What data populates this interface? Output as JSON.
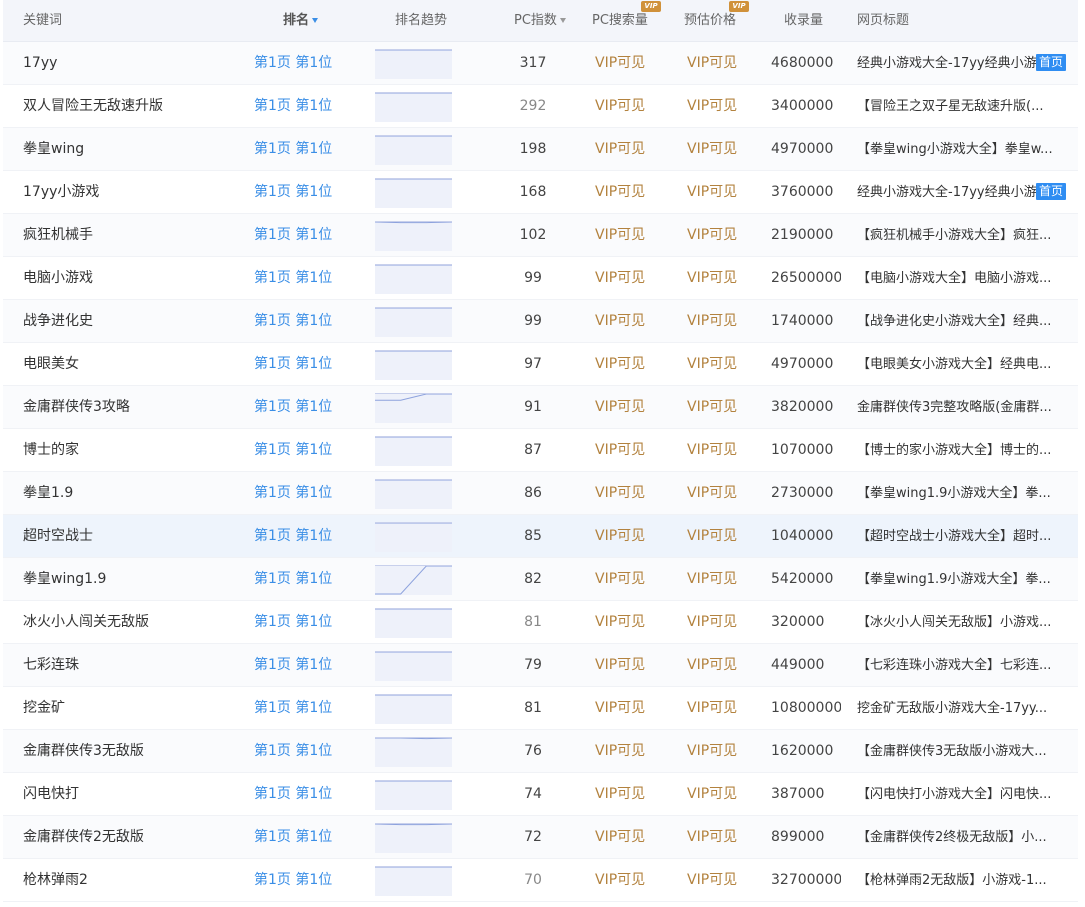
{
  "header": {
    "keyword": "关键词",
    "rank": "排名",
    "trend": "排名趋势",
    "pc_index": "PC指数",
    "pc_search": "PC搜索量",
    "est_price": "预估价格",
    "indexed": "收录量",
    "page_title": "网页标题",
    "vip_badge": "VIP"
  },
  "colors": {
    "accent": "#3a8ee6",
    "vip": "#b3823e",
    "badge": "#d0913a",
    "homepage_tag": "#2f8df2"
  },
  "rows": [
    {
      "keyword": "17yy",
      "rank": "第1页 第1位",
      "pc_index": "317",
      "pc_search": "VIP可见",
      "est_price": "VIP可见",
      "indexed": "4680000",
      "title": "经典小游戏大全-17yy经典小游",
      "tag": "首页",
      "trend": [
        1,
        1,
        1,
        1
      ]
    },
    {
      "keyword": "双人冒险王无敌速升版",
      "rank": "第1页 第1位",
      "pc_index": "292",
      "pc_search": "VIP可见",
      "est_price": "VIP可见",
      "indexed": "3400000",
      "title": "【冒险王之双子星无敌速升版(...",
      "tag": "",
      "trend": [
        1,
        1,
        1,
        1
      ]
    },
    {
      "keyword": "拳皇wing",
      "rank": "第1页 第1位",
      "pc_index": "198",
      "pc_search": "VIP可见",
      "est_price": "VIP可见",
      "indexed": "4970000",
      "title": "【拳皇wing小游戏大全】拳皇w...",
      "tag": "",
      "trend": [
        1,
        1,
        1,
        1
      ]
    },
    {
      "keyword": "17yy小游戏",
      "rank": "第1页 第1位",
      "pc_index": "168",
      "pc_search": "VIP可见",
      "est_price": "VIP可见",
      "indexed": "3760000",
      "title": "经典小游戏大全-17yy经典小游",
      "tag": "首页",
      "trend": [
        1,
        1,
        1,
        1
      ]
    },
    {
      "keyword": "疯狂机械手",
      "rank": "第1页 第1位",
      "pc_index": "102",
      "pc_search": "VIP可见",
      "est_price": "VIP可见",
      "indexed": "2190000",
      "title": "【疯狂机械手小游戏大全】疯狂...",
      "tag": "",
      "trend": [
        1,
        1.2,
        1.2,
        1
      ]
    },
    {
      "keyword": "电脑小游戏",
      "rank": "第1页 第1位",
      "pc_index": "99",
      "pc_search": "VIP可见",
      "est_price": "VIP可见",
      "indexed": "26500000",
      "title": "【电脑小游戏大全】电脑小游戏...",
      "tag": "",
      "trend": [
        1,
        1,
        1,
        1
      ]
    },
    {
      "keyword": "战争进化史",
      "rank": "第1页 第1位",
      "pc_index": "99",
      "pc_search": "VIP可见",
      "est_price": "VIP可见",
      "indexed": "1740000",
      "title": "【战争进化史小游戏大全】经典...",
      "tag": "",
      "trend": [
        1,
        1,
        1,
        1
      ]
    },
    {
      "keyword": "电眼美女",
      "rank": "第1页 第1位",
      "pc_index": "97",
      "pc_search": "VIP可见",
      "est_price": "VIP可见",
      "indexed": "4970000",
      "title": "【电眼美女小游戏大全】经典电...",
      "tag": "",
      "trend": [
        1,
        1,
        1,
        1
      ]
    },
    {
      "keyword": "金庸群侠传3攻略",
      "rank": "第1页 第1位",
      "pc_index": "91",
      "pc_search": "VIP可见",
      "est_price": "VIP可见",
      "indexed": "3820000",
      "title": "金庸群侠传3完整攻略版(金庸群...",
      "tag": "",
      "trend": [
        3,
        3,
        1,
        1
      ]
    },
    {
      "keyword": "博士的家",
      "rank": "第1页 第1位",
      "pc_index": "87",
      "pc_search": "VIP可见",
      "est_price": "VIP可见",
      "indexed": "1070000",
      "title": "【博士的家小游戏大全】博士的...",
      "tag": "",
      "trend": [
        1,
        1,
        1,
        1
      ]
    },
    {
      "keyword": "拳皇1.9",
      "rank": "第1页 第1位",
      "pc_index": "86",
      "pc_search": "VIP可见",
      "est_price": "VIP可见",
      "indexed": "2730000",
      "title": "【拳皇wing1.9小游戏大全】拳...",
      "tag": "",
      "trend": [
        1,
        1,
        1,
        1
      ]
    },
    {
      "keyword": "超时空战士",
      "rank": "第1页 第1位",
      "pc_index": "85",
      "pc_search": "VIP可见",
      "est_price": "VIP可见",
      "indexed": "1040000",
      "title": "【超时空战士小游戏大全】超时...",
      "tag": "",
      "trend": [
        1,
        1,
        1,
        1
      ]
    },
    {
      "keyword": "拳皇wing1.9",
      "rank": "第1页 第1位",
      "pc_index": "82",
      "pc_search": "VIP可见",
      "est_price": "VIP可见",
      "indexed": "5420000",
      "title": "【拳皇wing1.9小游戏大全】拳...",
      "tag": "",
      "trend": [
        10,
        10,
        1,
        1
      ]
    },
    {
      "keyword": "冰火小人闯关无敌版",
      "rank": "第1页 第1位",
      "pc_index": "81",
      "pc_search": "VIP可见",
      "est_price": "VIP可见",
      "indexed": "320000",
      "title": "【冰火小人闯关无敌版】小游戏...",
      "tag": "",
      "trend": [
        1,
        1,
        1,
        1
      ]
    },
    {
      "keyword": "七彩连珠",
      "rank": "第1页 第1位",
      "pc_index": "79",
      "pc_search": "VIP可见",
      "est_price": "VIP可见",
      "indexed": "449000",
      "title": "【七彩连珠小游戏大全】七彩连...",
      "tag": "",
      "trend": [
        1,
        1,
        1,
        1
      ]
    },
    {
      "keyword": "挖金矿",
      "rank": "第1页 第1位",
      "pc_index": "81",
      "pc_search": "VIP可见",
      "est_price": "VIP可见",
      "indexed": "10800000",
      "title": "挖金矿无敌版小游戏大全-17yy...",
      "tag": "",
      "trend": [
        1,
        1,
        1,
        1
      ]
    },
    {
      "keyword": "金庸群侠传3无敌版",
      "rank": "第1页 第1位",
      "pc_index": "76",
      "pc_search": "VIP可见",
      "est_price": "VIP可见",
      "indexed": "1620000",
      "title": "【金庸群侠传3无敌版小游戏大...",
      "tag": "",
      "trend": [
        1,
        1,
        1.2,
        1
      ]
    },
    {
      "keyword": "闪电快打",
      "rank": "第1页 第1位",
      "pc_index": "74",
      "pc_search": "VIP可见",
      "est_price": "VIP可见",
      "indexed": "387000",
      "title": "【闪电快打小游戏大全】闪电快...",
      "tag": "",
      "trend": [
        1,
        1,
        1,
        1
      ]
    },
    {
      "keyword": "金庸群侠传2无敌版",
      "rank": "第1页 第1位",
      "pc_index": "72",
      "pc_search": "VIP可见",
      "est_price": "VIP可见",
      "indexed": "899000",
      "title": "【金庸群侠传2终极无敌版】小...",
      "tag": "",
      "trend": [
        1,
        1.2,
        1.2,
        1
      ]
    },
    {
      "keyword": "枪林弹雨2",
      "rank": "第1页 第1位",
      "pc_index": "70",
      "pc_search": "VIP可见",
      "est_price": "VIP可见",
      "indexed": "32700000",
      "title": "【枪林弹雨2无敌版】小游戏-1...",
      "tag": "",
      "trend": [
        1,
        1,
        1,
        1
      ]
    }
  ]
}
